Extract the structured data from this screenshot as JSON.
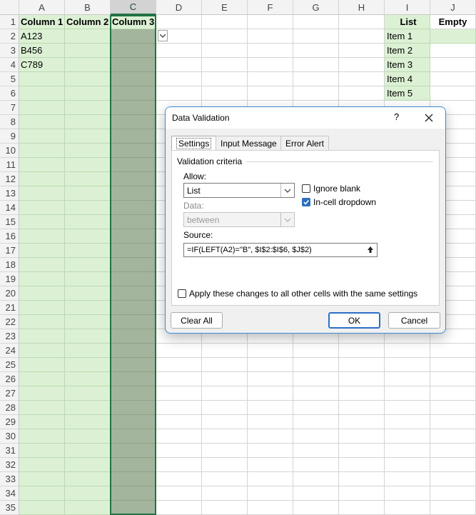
{
  "sheet": {
    "columns": [
      "A",
      "B",
      "C",
      "D",
      "E",
      "F",
      "G",
      "H",
      "I",
      "J"
    ],
    "row_numbers": [
      "1",
      "2",
      "3",
      "4",
      "5",
      "6",
      "7",
      "8",
      "9",
      "10",
      "11",
      "12",
      "13",
      "14",
      "15",
      "16",
      "17",
      "18",
      "19",
      "20",
      "21",
      "22",
      "23",
      "24",
      "25",
      "26",
      "27",
      "28",
      "29",
      "30",
      "31",
      "32",
      "33",
      "34",
      "35"
    ],
    "headers": {
      "a1": "Column 1",
      "b1": "Column 2",
      "c1": "Column 3",
      "i1": "List",
      "j1": "Empty"
    },
    "column_a_values": [
      "A123",
      "B456",
      "C789"
    ],
    "list_items": [
      "Item 1",
      "Item 2",
      "Item 3",
      "Item 4",
      "Item 5"
    ],
    "colors": {
      "green_fill": "#dcf1d4",
      "selected_fill": "#a3b59c",
      "selection_border": "#217346"
    }
  },
  "dialog": {
    "title": "Data Validation",
    "help": "?",
    "tabs": [
      "Settings",
      "Input Message",
      "Error Alert"
    ],
    "active_tab": "Settings",
    "group_title": "Validation criteria",
    "allow_label": "Allow:",
    "allow_value": "List",
    "data_label": "Data:",
    "data_value": "between",
    "ignore_blank_label": "Ignore blank",
    "ignore_blank_checked": false,
    "incell_label": "In-cell dropdown",
    "incell_checked": true,
    "source_label": "Source:",
    "source_value": "=IF(LEFT(A2)=\"B\", $I$2:$I$6, $J$2)",
    "apply_label": "Apply these changes to all other cells with the same settings",
    "apply_checked": false,
    "clear_all_label": "Clear All",
    "ok_label": "OK",
    "cancel_label": "Cancel"
  }
}
